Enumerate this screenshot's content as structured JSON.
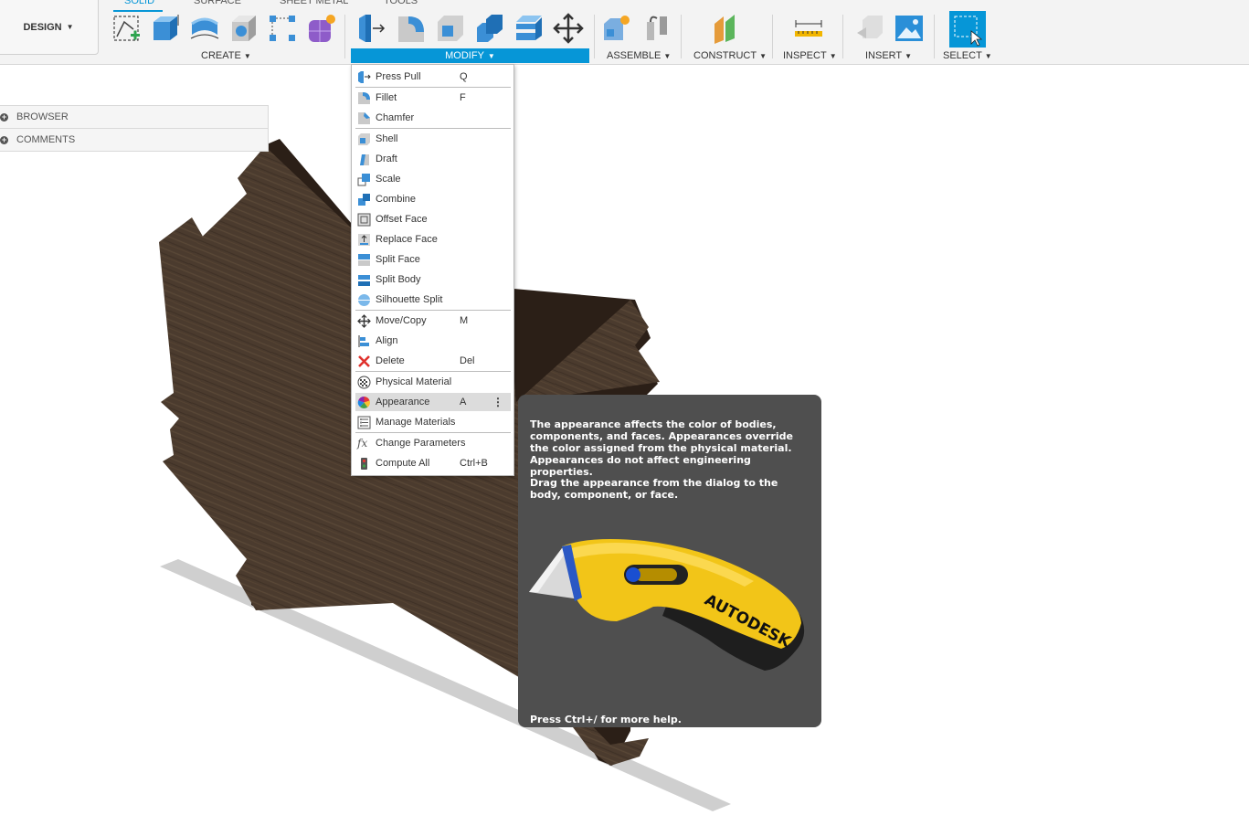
{
  "workspace": {
    "label": "DESIGN"
  },
  "tabs": [
    "SOLID",
    "SURFACE",
    "SHEET METAL",
    "TOOLS"
  ],
  "groups": {
    "create": "CREATE",
    "modify": "MODIFY",
    "assemble": "ASSEMBLE",
    "construct": "CONSTRUCT",
    "inspect": "INSPECT",
    "insert": "INSERT",
    "select": "SELECT"
  },
  "browser": {
    "browser_label": "BROWSER",
    "comments_label": "COMMENTS"
  },
  "menu": {
    "items": [
      {
        "label": "Press Pull",
        "shortcut": "Q",
        "icon": "press-pull-icon"
      },
      {
        "label": "Fillet",
        "shortcut": "F",
        "icon": "fillet-icon"
      },
      {
        "label": "Chamfer",
        "shortcut": "",
        "icon": "chamfer-icon"
      },
      {
        "label": "Shell",
        "shortcut": "",
        "icon": "shell-icon"
      },
      {
        "label": "Draft",
        "shortcut": "",
        "icon": "draft-icon"
      },
      {
        "label": "Scale",
        "shortcut": "",
        "icon": "scale-icon"
      },
      {
        "label": "Combine",
        "shortcut": "",
        "icon": "combine-icon"
      },
      {
        "label": "Offset Face",
        "shortcut": "",
        "icon": "offset-face-icon"
      },
      {
        "label": "Replace Face",
        "shortcut": "",
        "icon": "replace-face-icon"
      },
      {
        "label": "Split Face",
        "shortcut": "",
        "icon": "split-face-icon"
      },
      {
        "label": "Split Body",
        "shortcut": "",
        "icon": "split-body-icon"
      },
      {
        "label": "Silhouette Split",
        "shortcut": "",
        "icon": "silhouette-split-icon"
      },
      {
        "label": "Move/Copy",
        "shortcut": "M",
        "icon": "move-icon"
      },
      {
        "label": "Align",
        "shortcut": "",
        "icon": "align-icon"
      },
      {
        "label": "Delete",
        "shortcut": "Del",
        "icon": "delete-icon"
      },
      {
        "label": "Physical Material",
        "shortcut": "",
        "icon": "physical-material-icon"
      },
      {
        "label": "Appearance",
        "shortcut": "A",
        "icon": "appearance-icon"
      },
      {
        "label": "Manage Materials",
        "shortcut": "",
        "icon": "manage-materials-icon"
      },
      {
        "label": "Change Parameters",
        "shortcut": "",
        "icon": "fx-icon"
      },
      {
        "label": "Compute All",
        "shortcut": "Ctrl+B",
        "icon": "compute-all-icon"
      }
    ]
  },
  "tooltip": {
    "paragraph1": "The appearance affects the color of bodies, components, and faces. Appearances override the color assigned from the physical material. Appearances do not affect engineering properties.",
    "paragraph2": "Drag the appearance from the dialog to the body, component, or face.",
    "image_brand": "AUTODESK",
    "footer": "Press Ctrl+/ for more help."
  },
  "colors": {
    "accent": "#0696d7",
    "wood": "#4a3a2d",
    "tooltip_bg": "#4f4f4f",
    "knife_yellow": "#f2c518"
  }
}
